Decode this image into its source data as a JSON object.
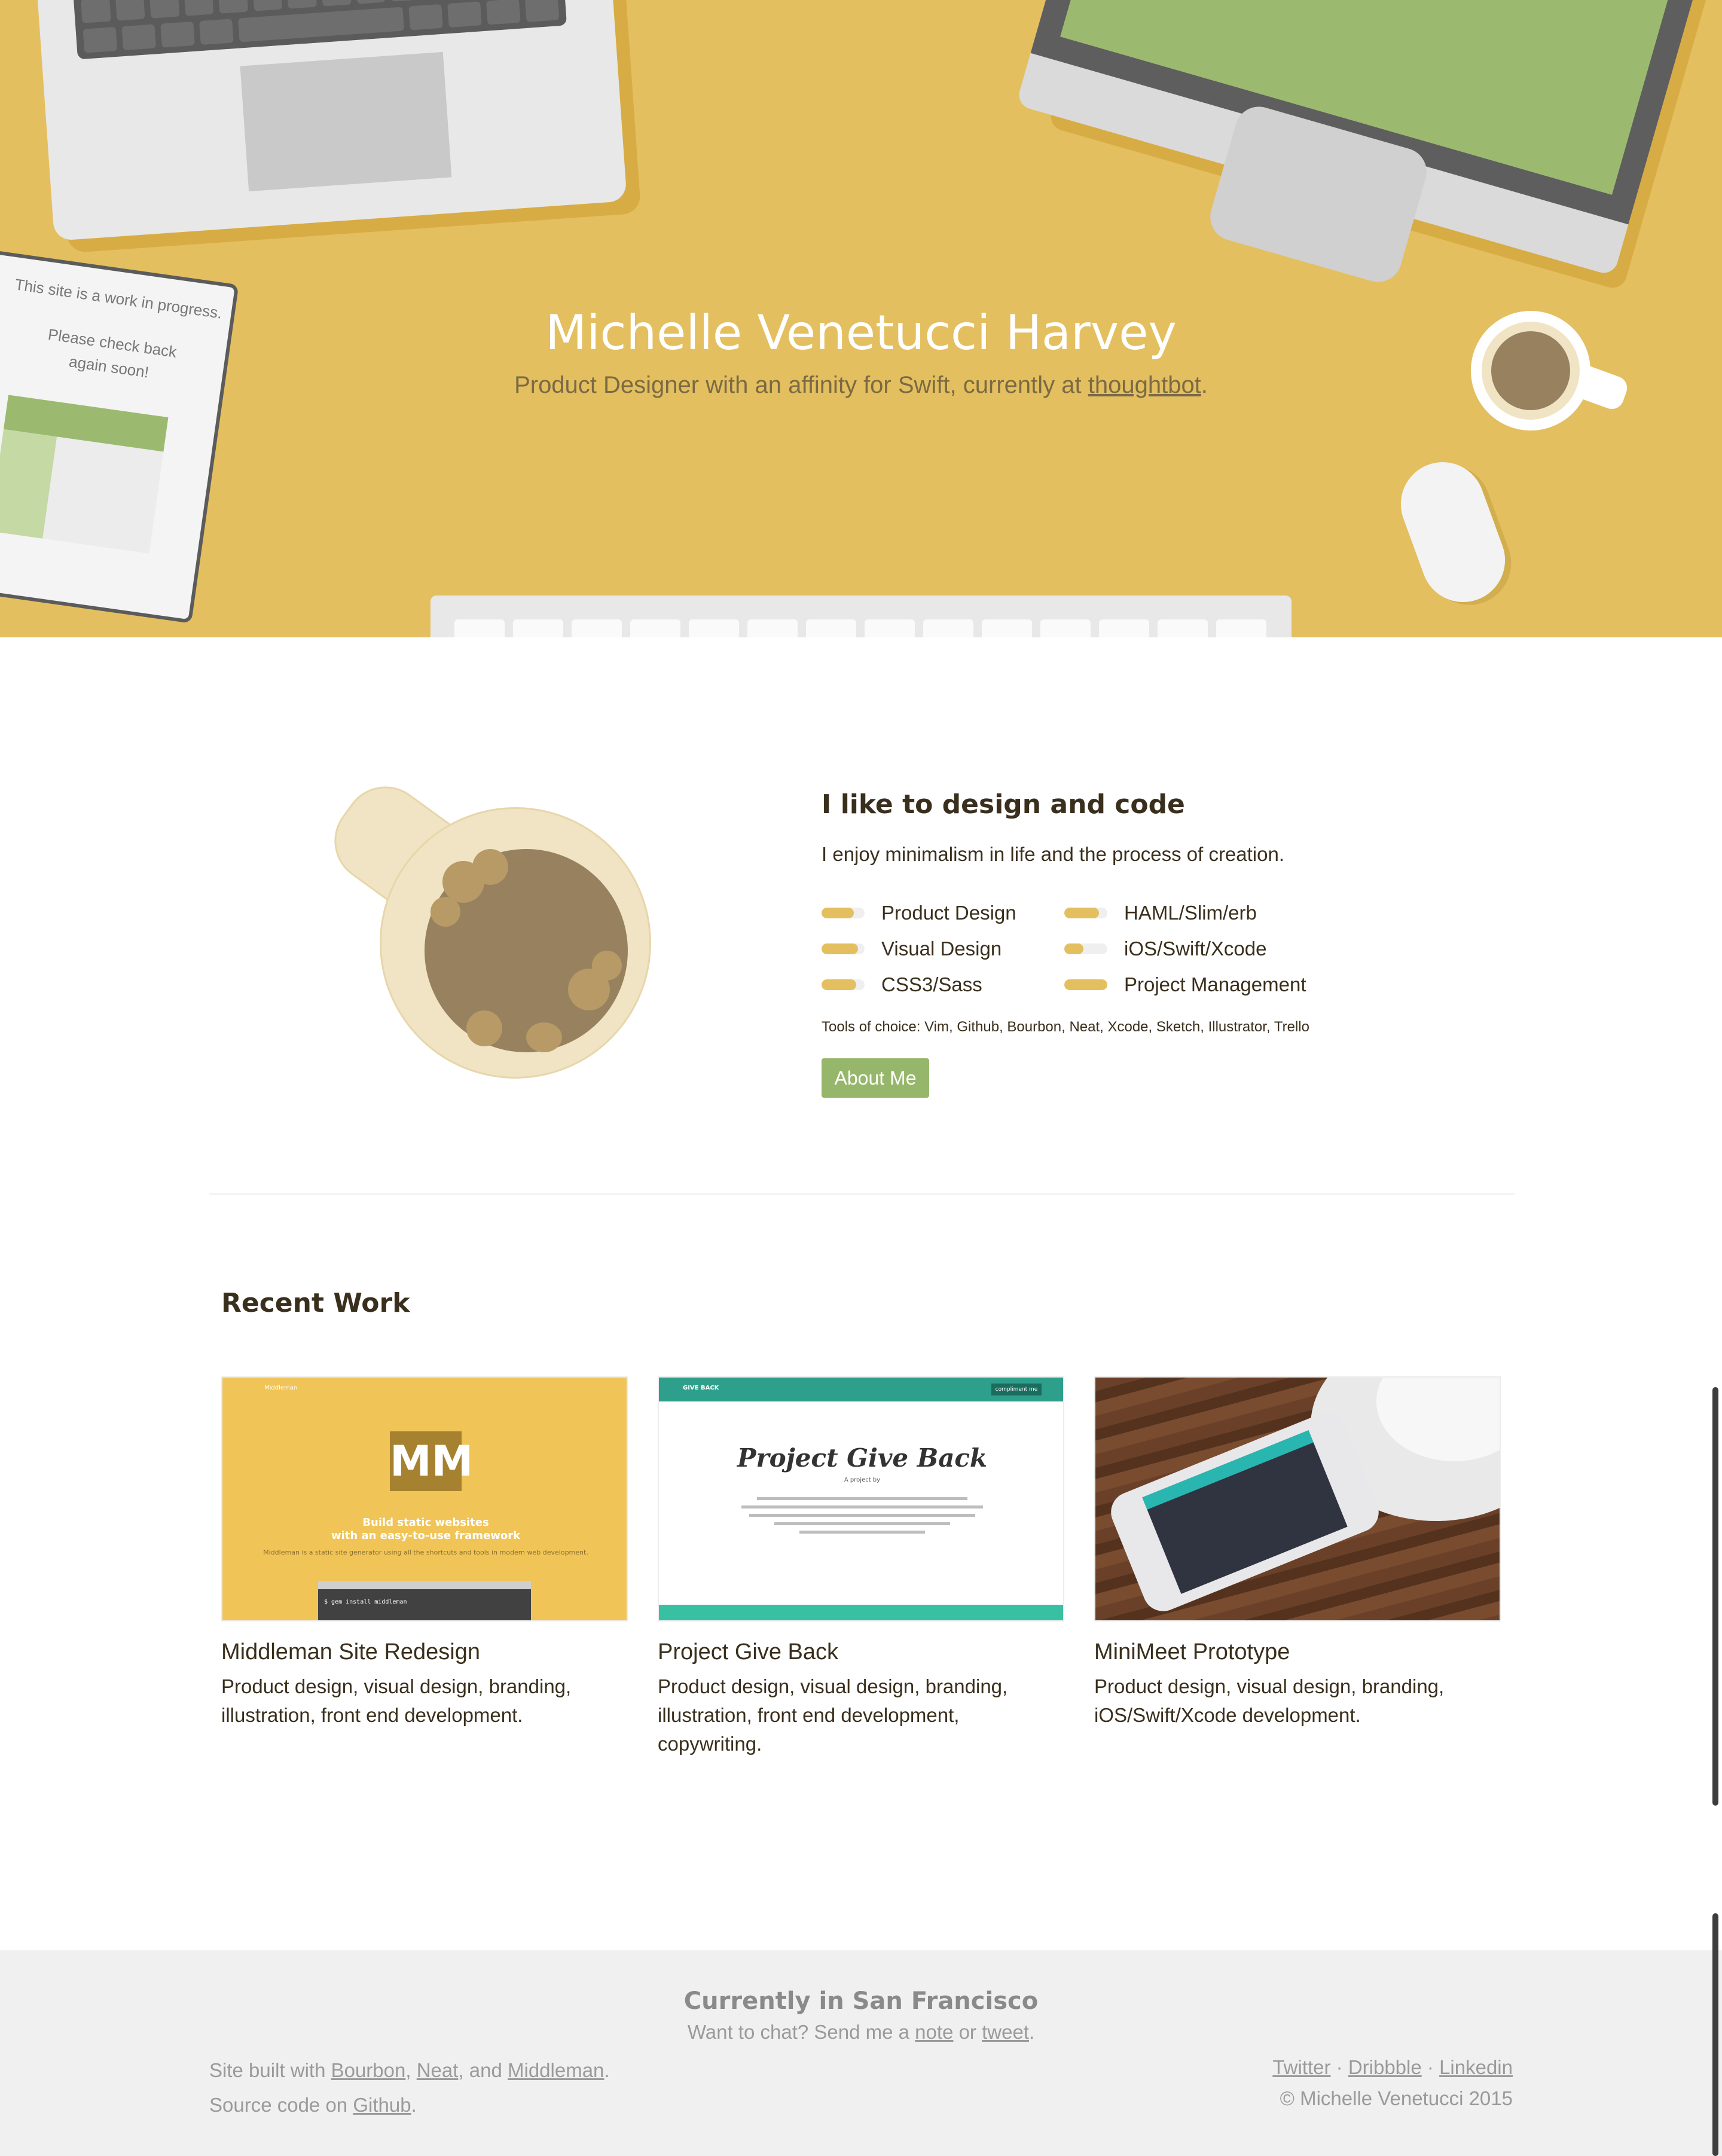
{
  "hero": {
    "title": "Michelle Venetucci Harvey",
    "subtitle_prefix": "Product Designer with an affinity for Swift, currently at ",
    "subtitle_link": "thoughtbot",
    "subtitle_suffix": ".",
    "tablet_line1": "This site is a work in progress.",
    "tablet_line2": "Please check back",
    "tablet_line3": "again soon!"
  },
  "about": {
    "title": "I like to design and code",
    "text": "I enjoy minimalism in life and the process of creation.",
    "skills": [
      {
        "label": "Product Design",
        "level": 0.75
      },
      {
        "label": "Visual Design",
        "level": 0.85
      },
      {
        "label": "CSS3/Sass",
        "level": 0.8
      },
      {
        "label": "HAML/Slim/erb",
        "level": 0.8
      },
      {
        "label": "iOS/Swift/Xcode",
        "level": 0.4
      },
      {
        "label": "Project Management",
        "level": 1.0
      }
    ],
    "tools": "Tools of choice: Vim, Github, Bourbon, Neat, Xcode, Sketch, Illustrator, Trello",
    "button": "About Me"
  },
  "work": {
    "title": "Recent Work",
    "items": [
      {
        "title": "Middleman Site Redesign",
        "desc": "Product design, visual design, branding, illustration, front end development."
      },
      {
        "title": "Project Give Back",
        "desc": "Product design, visual design, branding, illustration, front end development, copywriting."
      },
      {
        "title": "MiniMeet Prototype",
        "desc": "Product design, visual design, branding, iOS/Swift/Xcode development."
      }
    ],
    "middleman_thumb": {
      "nav": "Middleman",
      "logo": "MM",
      "headline1": "Build static websites",
      "headline2": "with an easy-to-use framework",
      "paragraph": "Middleman is a static site generator using all the shortcuts and tools in modern web development.",
      "command": "$ gem install middleman"
    },
    "giveback_thumb": {
      "bar_label": "GIVE BACK",
      "pill": "compliment me",
      "title": "Project Give Back",
      "byline": "A project by"
    }
  },
  "footer": {
    "title": "Currently in San Francisco",
    "chat_prefix": "Want to chat? Send me a ",
    "chat_note": "note",
    "chat_or": " or ",
    "chat_tweet": "tweet",
    "chat_suffix": ".",
    "built_prefix": "Site built with ",
    "bourbon": "Bourbon",
    "comma": ", ",
    "neat": "Neat",
    "and": ", and ",
    "middleman": "Middleman",
    "period": ".",
    "source_prefix": "Source code on ",
    "github": "Github",
    "twitter": "Twitter",
    "dot": " · ",
    "dribbble": "Dribbble",
    "linkedin": "Linkedin",
    "copyright": "© Michelle Venetucci 2015"
  },
  "colors": {
    "hero_bg": "#e4bf5f",
    "accent_green": "#96b66b",
    "skill_fill": "#e4bf5f",
    "footer_bg": "#f0f0f0"
  }
}
